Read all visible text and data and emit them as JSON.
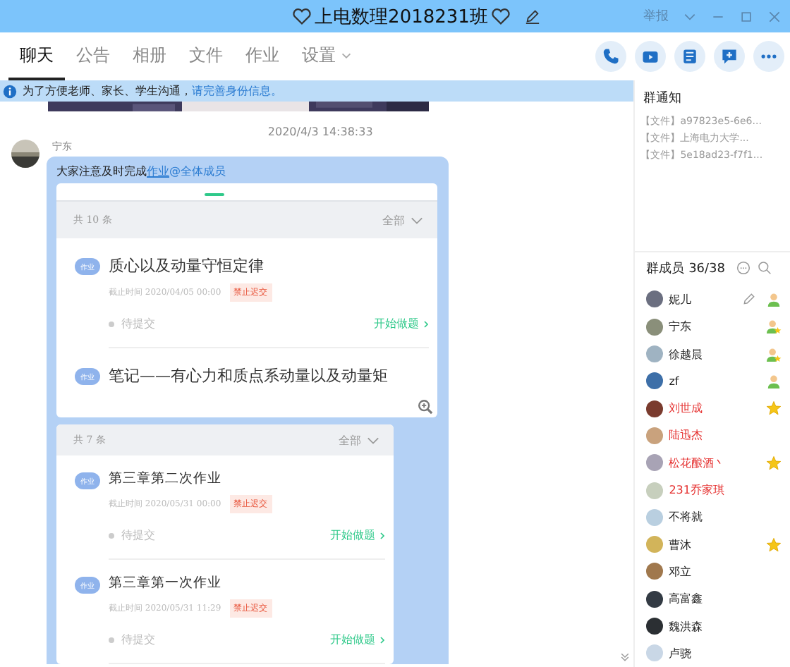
{
  "window": {
    "title": "上电数理2018231班",
    "report": "举报"
  },
  "tabs": [
    {
      "label": "聊天",
      "selected": true,
      "dropdown": false
    },
    {
      "label": "公告",
      "selected": false,
      "dropdown": false
    },
    {
      "label": "相册",
      "selected": false,
      "dropdown": false
    },
    {
      "label": "文件",
      "selected": false,
      "dropdown": false
    },
    {
      "label": "作业",
      "selected": false,
      "dropdown": false
    },
    {
      "label": "设置",
      "selected": false,
      "dropdown": true
    }
  ],
  "notice": {
    "text": "为了方便老师、家长、学生沟通，",
    "link": "请完善身份信息。"
  },
  "chat": {
    "timestamp": "2020/4/3 14:38:33",
    "sender": "宁东",
    "message": {
      "text": "大家注意及时完成",
      "link": "作业",
      "mention": "@全体成员"
    },
    "cards": [
      {
        "count": "共 10 条",
        "filter": "全部",
        "items": [
          {
            "badge": "作业",
            "title": "质心以及动量守恒定律",
            "deadline": "截止时间 2020/04/05 00:00",
            "tag": "禁止迟交",
            "status": "待提交",
            "action": "开始做题"
          },
          {
            "badge": "作业",
            "title": "笔记——有心力和质点系动量以及动量矩"
          }
        ]
      },
      {
        "count": "共 7 条",
        "filter": "全部",
        "items": [
          {
            "badge": "作业",
            "title": "第三章第二次作业",
            "deadline": "截止时间 2020/05/31 00:00",
            "tag": "禁止迟交",
            "status": "待提交",
            "action": "开始做题"
          },
          {
            "badge": "作业",
            "title": "第三章第一次作业",
            "deadline": "截止时间 2020/05/31 11:29",
            "tag": "禁止迟交",
            "status": "待提交",
            "action": "开始做题"
          }
        ]
      }
    ]
  },
  "side": {
    "notice_title": "群通知",
    "files": [
      {
        "tag": "【文件】",
        "name": "a97823e5-6e6..."
      },
      {
        "tag": "【文件】",
        "name": "上海电力大学..."
      },
      {
        "tag": "【文件】",
        "name": "5e18ad23-f7f1..."
      }
    ],
    "members_title": "群成员 36/38",
    "members": [
      {
        "name": "妮儿",
        "highlighted": false,
        "editable": true,
        "kind": "person"
      },
      {
        "name": "宁东",
        "highlighted": false,
        "editable": false,
        "kind": "personstar"
      },
      {
        "name": "徐越晨",
        "highlighted": false,
        "editable": false,
        "kind": "personstar"
      },
      {
        "name": "zf",
        "highlighted": false,
        "editable": false,
        "kind": "person"
      },
      {
        "name": "刘世成",
        "highlighted": true,
        "editable": false,
        "kind": "star"
      },
      {
        "name": "陆迅杰",
        "highlighted": true,
        "editable": false,
        "kind": "plain"
      },
      {
        "name": "松花酿酒丶",
        "highlighted": true,
        "editable": false,
        "kind": "star"
      },
      {
        "name": "231乔家琪",
        "highlighted": true,
        "editable": false,
        "kind": "plain"
      },
      {
        "name": "不将就",
        "highlighted": false,
        "editable": false,
        "kind": "plain"
      },
      {
        "name": "曹沐",
        "highlighted": false,
        "editable": false,
        "kind": "star"
      },
      {
        "name": "邓立",
        "highlighted": false,
        "editable": false,
        "kind": "plain"
      },
      {
        "name": "高富鑫",
        "highlighted": false,
        "editable": false,
        "kind": "plain"
      },
      {
        "name": "魏洪森",
        "highlighted": false,
        "editable": false,
        "kind": "plain"
      },
      {
        "name": "卢骁",
        "highlighted": false,
        "editable": false,
        "kind": "plain"
      }
    ]
  }
}
